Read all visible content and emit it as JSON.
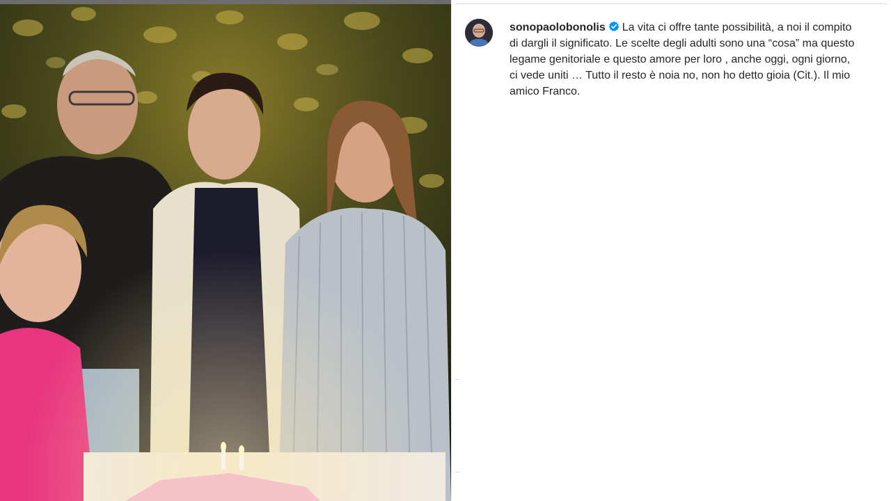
{
  "post": {
    "username": "sonopaolobonolis",
    "verified_icon": "verified-badge-icon",
    "caption": "La vita ci offre tante possibilità, a noi il compito di dargli il significato. Le scelte degli adulti sono una “cosa” ma questo legame genitoriale e questo amore per loro , anche oggi, ogni giorno, ci vede uniti … Tutto il resto è noia no, non ho detto gioia (Cit.). Il mio amico Franco."
  },
  "colors": {
    "text": "#262626",
    "verified_blue": "#0095f6",
    "divider": "#dbdbdb",
    "background": "#ffffff"
  },
  "icons": {
    "avatar": "profile-avatar",
    "verified": "verified-badge-icon"
  }
}
